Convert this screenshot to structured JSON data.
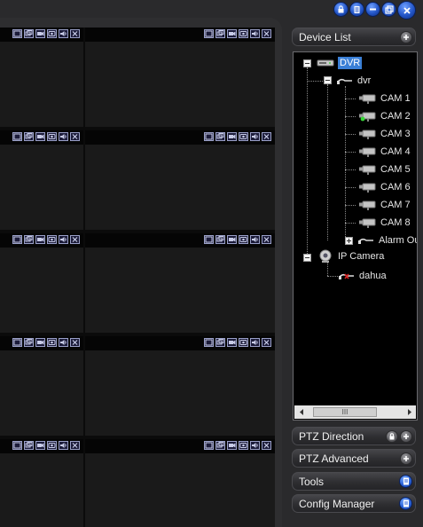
{
  "window_controls": {
    "icons": [
      "lock-icon",
      "document-icon",
      "minimize-icon",
      "restore-icon",
      "close-icon"
    ]
  },
  "video_grid": {
    "rows": 5,
    "columns": 2,
    "cell_tool_icons": [
      "fullscreen-icon",
      "screenshot-icon",
      "record-icon",
      "camera-switch-icon",
      "audio-icon",
      "close-icon"
    ]
  },
  "panel": {
    "device_list": {
      "label": "Device List"
    },
    "ptz_direction": {
      "label": "PTZ Direction"
    },
    "ptz_advanced": {
      "label": "PTZ Advanced"
    },
    "tools": {
      "label": "Tools"
    },
    "config_manager": {
      "label": "Config Manager"
    }
  },
  "tree": {
    "dvr_root": {
      "label": "DVR"
    },
    "dvr_device": {
      "label": "dvr"
    },
    "cams": [
      {
        "label": "CAM 1",
        "active": false
      },
      {
        "label": "CAM 2",
        "active": true
      },
      {
        "label": "CAM 3",
        "active": false
      },
      {
        "label": "CAM 4",
        "active": false
      },
      {
        "label": "CAM 5",
        "active": false
      },
      {
        "label": "CAM 6",
        "active": false
      },
      {
        "label": "CAM 7",
        "active": false
      },
      {
        "label": "CAM 8",
        "active": false
      }
    ],
    "alarm_out": {
      "label": "Alarm Ou"
    },
    "ip_camera_root": {
      "label": "IP Camera"
    },
    "ip_device": {
      "label": "dahua"
    },
    "scrollbar_thumb_label": "III"
  },
  "colors": {
    "selection": "#3a7fd6",
    "accent_blue": "#2a62d8",
    "panel_bg": "#2a2a2c",
    "video_bg": "#1a1a1a"
  }
}
